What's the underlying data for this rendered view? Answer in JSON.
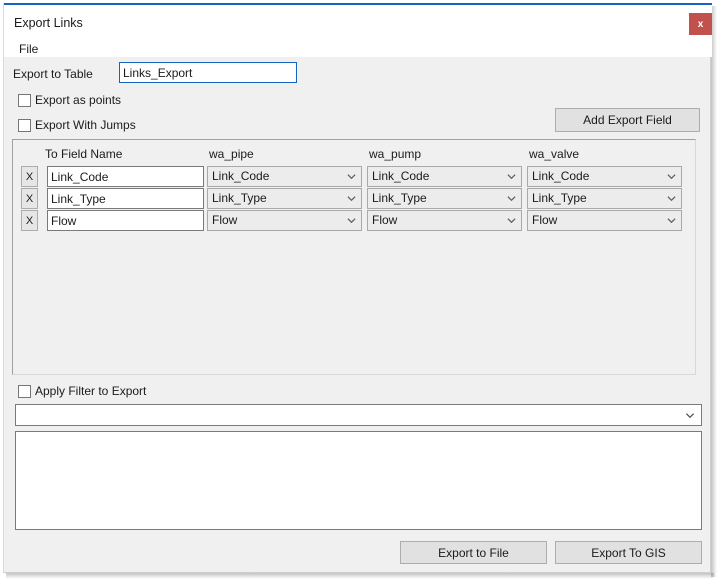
{
  "window": {
    "title": "Export Links",
    "close_label": "x",
    "accent_color": "#1565c0",
    "close_color": "#c2504d"
  },
  "menu": {
    "items": [
      {
        "label": "File"
      }
    ]
  },
  "form": {
    "export_to_table_label": "Export to Table",
    "export_to_table_value": "Links_Export",
    "export_to_table_placeholder": "",
    "checkboxes": [
      {
        "label": "Export as points",
        "checked": false
      },
      {
        "label": "Export With Jumps",
        "checked": false
      }
    ],
    "add_export_field_label": "Add Export Field"
  },
  "mapping": {
    "headers": [
      "To Field Name",
      "wa_pipe",
      "wa_pump",
      "wa_valve"
    ],
    "remove_label": "X",
    "rows": [
      {
        "to_field_name": "Link_Code",
        "wa_pipe": "Link_Code",
        "wa_pump": "Link_Code",
        "wa_valve": "Link_Code"
      },
      {
        "to_field_name": "Link_Type",
        "wa_pipe": "Link_Type",
        "wa_pump": "Link_Type",
        "wa_valve": "Link_Type"
      },
      {
        "to_field_name": "Flow",
        "wa_pipe": "Flow",
        "wa_pump": "Flow",
        "wa_valve": "Flow"
      }
    ]
  },
  "filter": {
    "apply_filter_label": "Apply Filter to Export",
    "apply_filter_checked": false,
    "combo_value": "",
    "combo_placeholder": "",
    "memo_value": "",
    "memo_placeholder": ""
  },
  "footer": {
    "export_to_file_label": "Export to File",
    "export_to_gis_label": "Export To GIS"
  }
}
